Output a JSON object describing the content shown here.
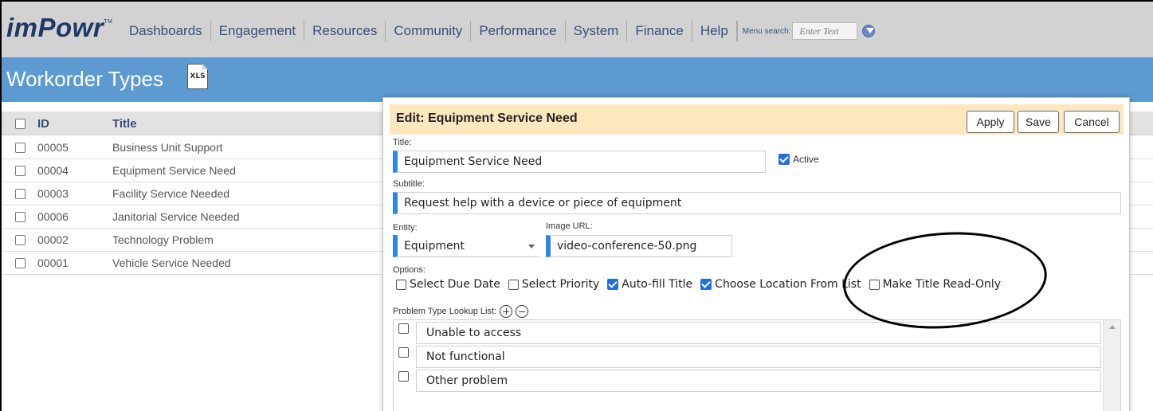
{
  "app": {
    "logo": "imPowr",
    "logo_mark": "TM",
    "nav": [
      "Dashboards",
      "Engagement",
      "Resources",
      "Community",
      "Performance",
      "System",
      "Finance",
      "Help"
    ],
    "menu_search_label": "Menu search:",
    "menu_search_placeholder": "Enter Text"
  },
  "page": {
    "title": "Workorder Types",
    "export_icon": "XLS",
    "columns": {
      "id": "ID",
      "title": "Title"
    },
    "rows": [
      {
        "id": "00005",
        "title": "Business Unit Support"
      },
      {
        "id": "00004",
        "title": "Equipment Service Need"
      },
      {
        "id": "00003",
        "title": "Facility Service Needed"
      },
      {
        "id": "00006",
        "title": "Janitorial Service Needed"
      },
      {
        "id": "00002",
        "title": "Technology Problem"
      },
      {
        "id": "00001",
        "title": "Vehicle Service Needed"
      }
    ]
  },
  "dialog": {
    "title": "Edit: Equipment Service Need",
    "buttons": {
      "apply": "Apply",
      "save": "Save",
      "cancel": "Cancel"
    },
    "title_label": "Title:",
    "title_value": "Equipment Service Need",
    "active_label": "Active",
    "active_checked": true,
    "subtitle_label": "Subtitle:",
    "subtitle_value": "Request help with a device or piece of equipment",
    "entity_label": "Entity:",
    "entity_value": "Equipment",
    "image_url_label": "Image URL:",
    "image_url_value": "video-conference-50.png",
    "options_label": "Options:",
    "options": [
      {
        "label": "Select Due Date",
        "checked": false
      },
      {
        "label": "Select Priority",
        "checked": false
      },
      {
        "label": "Auto-fill Title",
        "checked": true
      },
      {
        "label": "Choose Location From List",
        "checked": true
      },
      {
        "label": "Make Title Read-Only",
        "checked": false
      }
    ],
    "problem_list_label": "Problem Type Lookup List:",
    "problems": [
      "Unable to access",
      "Not functional",
      "Other problem"
    ]
  },
  "colors": {
    "nav_bg": "#d2d2d2",
    "header_bg": "#5d9ad2",
    "dialog_header_bg": "#fde7be",
    "accent": "#2b86e8",
    "checkbox_checked": "#1f6fe0",
    "nav_text": "#3a4e78"
  }
}
